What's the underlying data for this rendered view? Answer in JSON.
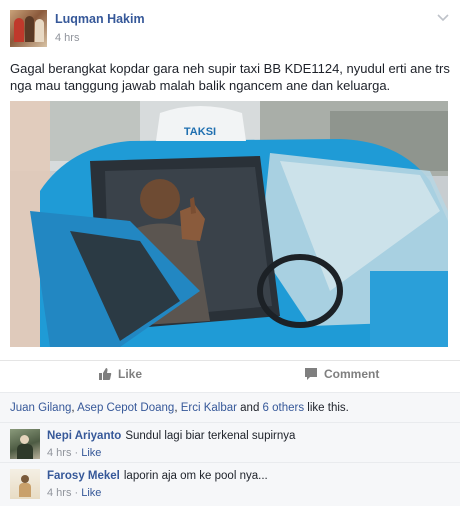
{
  "post": {
    "author": "Luqman Hakim",
    "time": "4 hrs",
    "status_text": "Gagal berangkat kopdar gara neh supir taxi BB KDE1124, nyudul erti ane trs nga mau tanggung jawab malah balik ngancem ane dan keluarga.",
    "photo_sign_text": "TAKSI"
  },
  "actions": {
    "like_label": "Like",
    "comment_label": "Comment"
  },
  "likes": {
    "names": [
      "Juan Gilang",
      "Asep Cepot Doang",
      "Erci Kalbar"
    ],
    "sep1": ", ",
    "sep2": ", ",
    "and_text": " and ",
    "others_link": "6 others",
    "suffix": " like this."
  },
  "comments": [
    {
      "name": "Nepi Ariyanto",
      "text": "Sundul lagi biar terkenal supirnya",
      "time": "4 hrs",
      "dot": " · ",
      "like": "Like"
    },
    {
      "name": "Farosy Mekel",
      "text": "laporin aja om ke pool nya...",
      "time": "4 hrs",
      "dot": " · ",
      "like": "Like"
    }
  ],
  "colors": {
    "link": "#365899",
    "meta": "#90949c",
    "car_blue": "#1f9bd6"
  },
  "icons": [
    "chevron-down-icon",
    "thumbs-up-icon",
    "comment-icon"
  ]
}
